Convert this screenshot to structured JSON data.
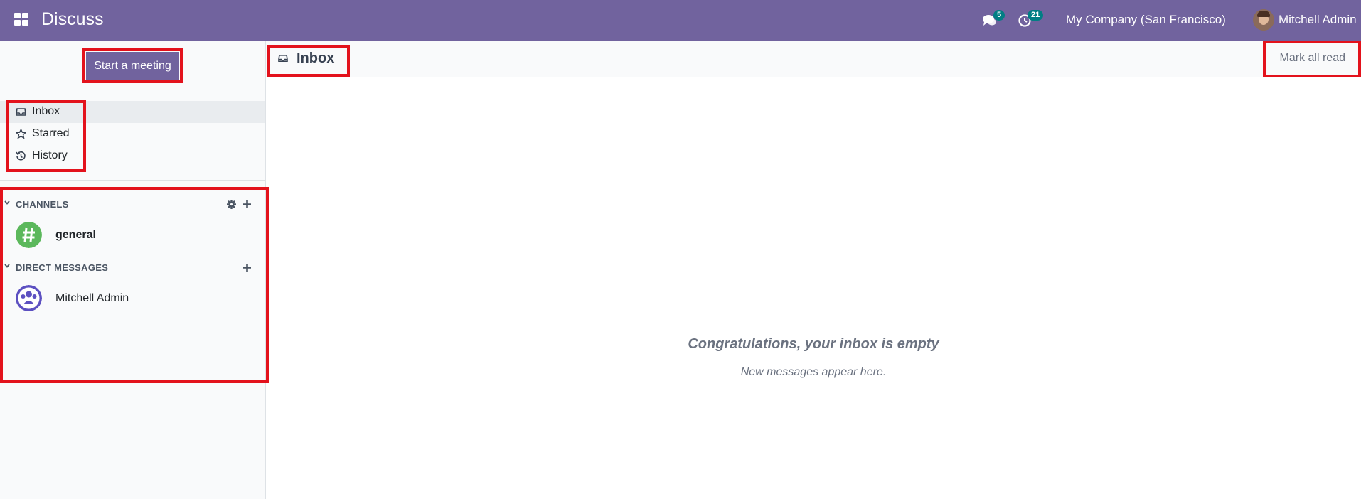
{
  "navbar": {
    "app_title": "Discuss",
    "messages_badge": "5",
    "activities_badge": "21",
    "company": "My Company (San Francisco)",
    "user_name": "Mitchell Admin"
  },
  "sidebar": {
    "start_meeting_label": "Start a meeting",
    "mailboxes": [
      {
        "label": "Inbox",
        "icon": "inbox-icon"
      },
      {
        "label": "Starred",
        "icon": "star-icon"
      },
      {
        "label": "History",
        "icon": "history-icon"
      }
    ],
    "channels": {
      "label": "CHANNELS",
      "items": [
        {
          "name": "general",
          "icon": "hashtag-icon"
        }
      ]
    },
    "direct_messages": {
      "label": "DIRECT MESSAGES",
      "items": [
        {
          "name": "Mitchell Admin",
          "icon": "user-group-icon"
        }
      ]
    }
  },
  "main": {
    "title": "Inbox",
    "mark_all_read_label": "Mark all read",
    "empty_title": "Congratulations, your inbox is empty",
    "empty_subtitle": "New messages appear here."
  },
  "colors": {
    "navbar": "#71639e",
    "highlight": "#e3121c",
    "channel_icon": "#5cb85c",
    "dm_icon": "#5c50c1",
    "badge": "#017e84"
  }
}
